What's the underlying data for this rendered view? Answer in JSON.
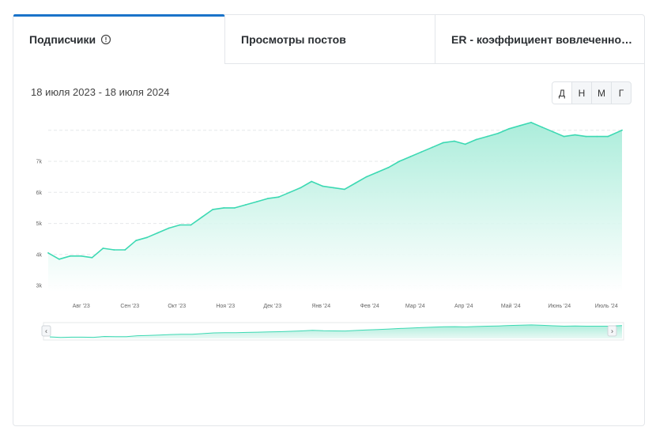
{
  "tabs": [
    {
      "label": "Подписчики",
      "active": true,
      "icon": "info-circle-icon"
    },
    {
      "label": "Просмотры постов",
      "active": false
    },
    {
      "label": "ER - коэффициент вовлеченно…",
      "active": false
    }
  ],
  "date_range": "18 июля 2023 - 18 июля 2024",
  "period_buttons": [
    "Д",
    "Н",
    "М",
    "Г"
  ],
  "colors": {
    "accent": "#1a73c9",
    "line": "#3dd9b3",
    "fill_top": "#a7ecd9",
    "fill_bottom": "#ffffff"
  },
  "navigator": {
    "left_arrow": "‹",
    "right_arrow": "›"
  },
  "chart_data": {
    "type": "area",
    "title": "",
    "xlabel": "",
    "ylabel": "",
    "ylim": [
      2800,
      8400
    ],
    "y_ticks": [
      {
        "label": "3k",
        "value": 3000
      },
      {
        "label": "4k",
        "value": 4000
      },
      {
        "label": "5k",
        "value": 5000
      },
      {
        "label": "6k",
        "value": 6000
      },
      {
        "label": "7k",
        "value": 7000
      }
    ],
    "x_ticks": [
      "Авг '23",
      "Сен '23",
      "Окт '23",
      "Ноя '23",
      "Дек '23",
      "Янв '24",
      "Фев '24",
      "Мар '24",
      "Апр '24",
      "Май '24",
      "Июнь '24",
      "Июль '24"
    ],
    "grid": true,
    "legend": "none",
    "series": [
      {
        "x": [
          "2023-07-18",
          "2023-07-25",
          "2023-08-01",
          "2023-08-08",
          "2023-08-15",
          "2023-08-22",
          "2023-08-29",
          "2023-09-05",
          "2023-09-12",
          "2023-09-19",
          "2023-09-26",
          "2023-10-03",
          "2023-10-10",
          "2023-10-17",
          "2023-10-24",
          "2023-10-31",
          "2023-11-07",
          "2023-11-14",
          "2023-11-21",
          "2023-11-28",
          "2023-12-05",
          "2023-12-12",
          "2023-12-19",
          "2023-12-26",
          "2024-01-02",
          "2024-01-09",
          "2024-01-16",
          "2024-01-23",
          "2024-01-30",
          "2024-02-06",
          "2024-02-13",
          "2024-02-20",
          "2024-02-27",
          "2024-03-05",
          "2024-03-12",
          "2024-03-19",
          "2024-03-26",
          "2024-04-02",
          "2024-04-09",
          "2024-04-16",
          "2024-04-23",
          "2024-04-30",
          "2024-05-07",
          "2024-05-14",
          "2024-05-21",
          "2024-05-28",
          "2024-06-04",
          "2024-06-11",
          "2024-06-18",
          "2024-06-25",
          "2024-07-02",
          "2024-07-09",
          "2024-07-18"
        ],
        "values": [
          4050,
          3850,
          3950,
          3950,
          3900,
          4200,
          4150,
          4150,
          4450,
          4550,
          4700,
          4850,
          4950,
          4950,
          5200,
          5450,
          5500,
          5500,
          5600,
          5700,
          5800,
          5850,
          6000,
          6150,
          6350,
          6200,
          6150,
          6100,
          6300,
          6500,
          6650,
          6800,
          7000,
          7150,
          7300,
          7450,
          7600,
          7650,
          7550,
          7700,
          7800,
          7900,
          8050,
          8150,
          8250,
          8100,
          7950,
          7800,
          7850,
          7800,
          7800,
          7800,
          8000
        ]
      }
    ]
  }
}
